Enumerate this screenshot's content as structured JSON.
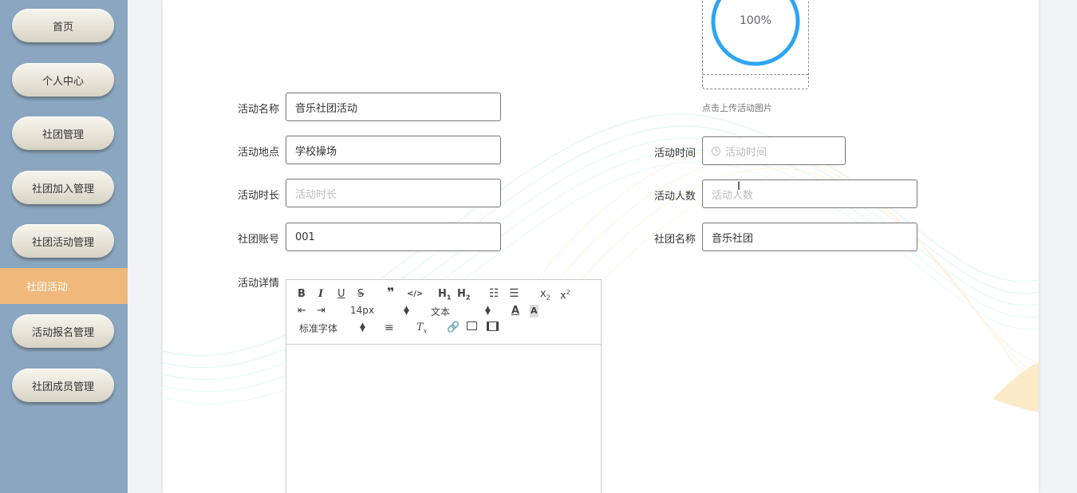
{
  "sidebar": {
    "items": [
      "首页",
      "个人中心",
      "社团管理",
      "社团加入管理",
      "社团活动管理",
      "社团活动",
      "活动报名管理",
      "社团成员管理"
    ]
  },
  "upload": {
    "progress_text": "100%",
    "progress": 1.0,
    "tip": "点击上传活动图片"
  },
  "form": {
    "name_label": "活动名称",
    "name_value": "音乐社团活动",
    "location_label": "活动地点",
    "location_value": "学校操场",
    "time_label": "活动时间",
    "time_placeholder": "活动时间",
    "duration_label": "活动时长",
    "duration_placeholder": "活动时长",
    "count_label": "活动人数",
    "count_placeholder": "活动人数",
    "club_account_label": "社团账号",
    "club_account_value": "001",
    "club_name_label": "社团名称",
    "club_name_value": "音乐社团",
    "detail_label": "活动详情"
  },
  "editor": {
    "size_value": "14px",
    "header_value": "文本",
    "font_value": "标准字体"
  },
  "colors": {
    "sidebar_bg": "#8aa6c0",
    "active_item": "#f0b87b",
    "progress": "#2ea5f5"
  },
  "icons": [
    "bold-icon",
    "italic-icon",
    "underline-icon",
    "strike-icon",
    "quote-icon",
    "code-icon",
    "h1-icon",
    "h2-icon",
    "ordered-list-icon",
    "bullet-list-icon",
    "subscript-icon",
    "superscript-icon",
    "outdent-icon",
    "indent-icon",
    "font-color-icon",
    "background-color-icon",
    "align-icon",
    "clear-format-icon",
    "link-icon",
    "image-icon",
    "video-icon",
    "clock-icon"
  ]
}
